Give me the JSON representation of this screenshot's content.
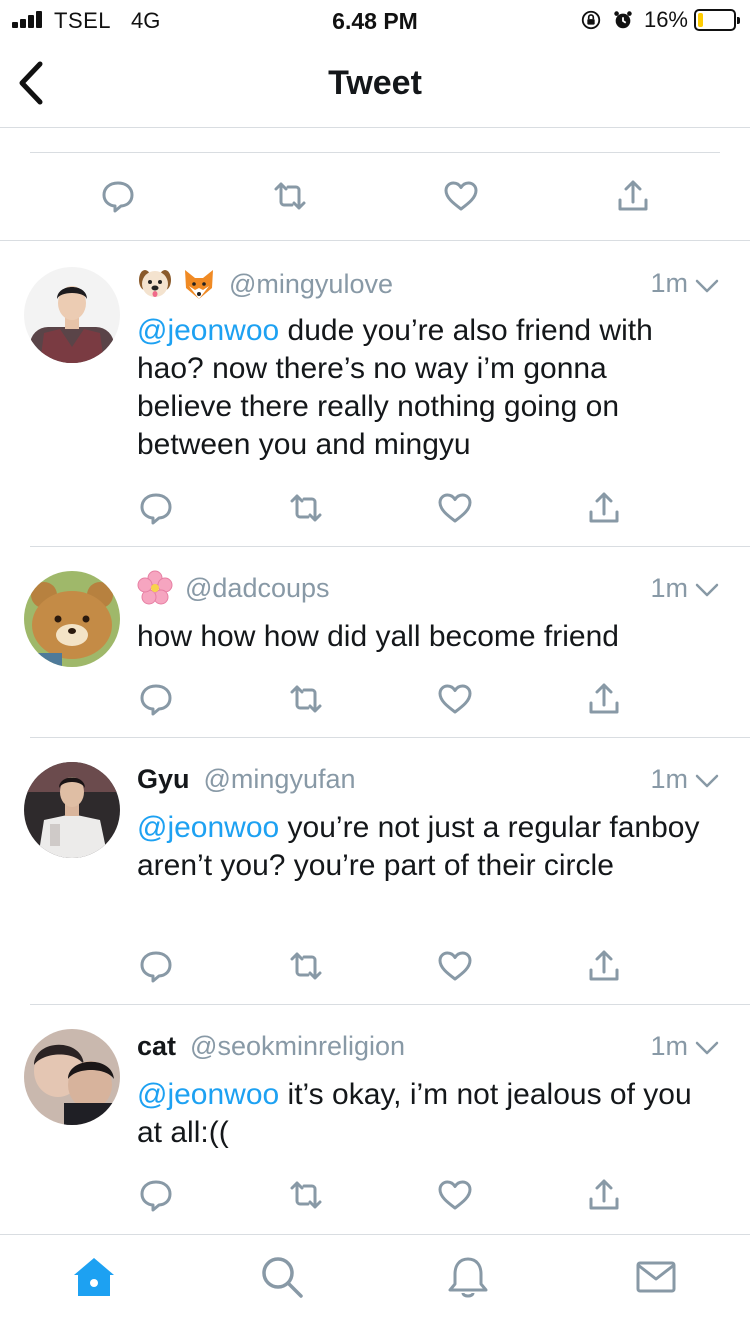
{
  "status_bar": {
    "carrier": "TSEL",
    "network": "4G",
    "time": "6.48 PM",
    "battery_percent": "16%",
    "battery_level": 0.16,
    "icons": [
      "signal-icon",
      "orientation-lock-icon",
      "alarm-icon",
      "battery-icon"
    ]
  },
  "nav": {
    "title": "Tweet",
    "back_icon": "chevron-left-icon"
  },
  "colors": {
    "accent": "#1da1f2",
    "muted": "#8899a6",
    "text": "#14171a",
    "divider": "#d9dde1",
    "battery_fill": "#ffcc00"
  },
  "replies": [
    {
      "display_name": "",
      "name_emojis": [
        "dog-face-emoji",
        "fox-face-emoji"
      ],
      "handle": "@mingyulove",
      "time": "1m",
      "mention": "@jeonwoo",
      "text": " dude you’re also friend with hao? now there’s no way i’m gonna believe there really nothing going on between you and mingyu"
    },
    {
      "display_name": "",
      "name_emojis": [
        "cherry-blossom-emoji"
      ],
      "handle": "@dadcoups",
      "time": "1m",
      "mention": "",
      "text": "how how how did yall become friend"
    },
    {
      "display_name": "Gyu",
      "name_emojis": [],
      "handle": "@mingyufan",
      "time": "1m",
      "mention": "@jeonwoo",
      "text": " you’re not just a regular fanboy aren’t you? you’re part of their circle"
    },
    {
      "display_name": "cat",
      "name_emojis": [],
      "handle": "@seokminreligion",
      "time": "1m",
      "mention": "@jeonwoo",
      "text": " it’s okay, i’m not jealous of you at all:(("
    }
  ],
  "tabs": [
    {
      "name": "home",
      "icon": "home-icon",
      "active": true
    },
    {
      "name": "search",
      "icon": "search-icon",
      "active": false
    },
    {
      "name": "notifications",
      "icon": "bell-icon",
      "active": false
    },
    {
      "name": "messages",
      "icon": "mail-icon",
      "active": false
    }
  ]
}
